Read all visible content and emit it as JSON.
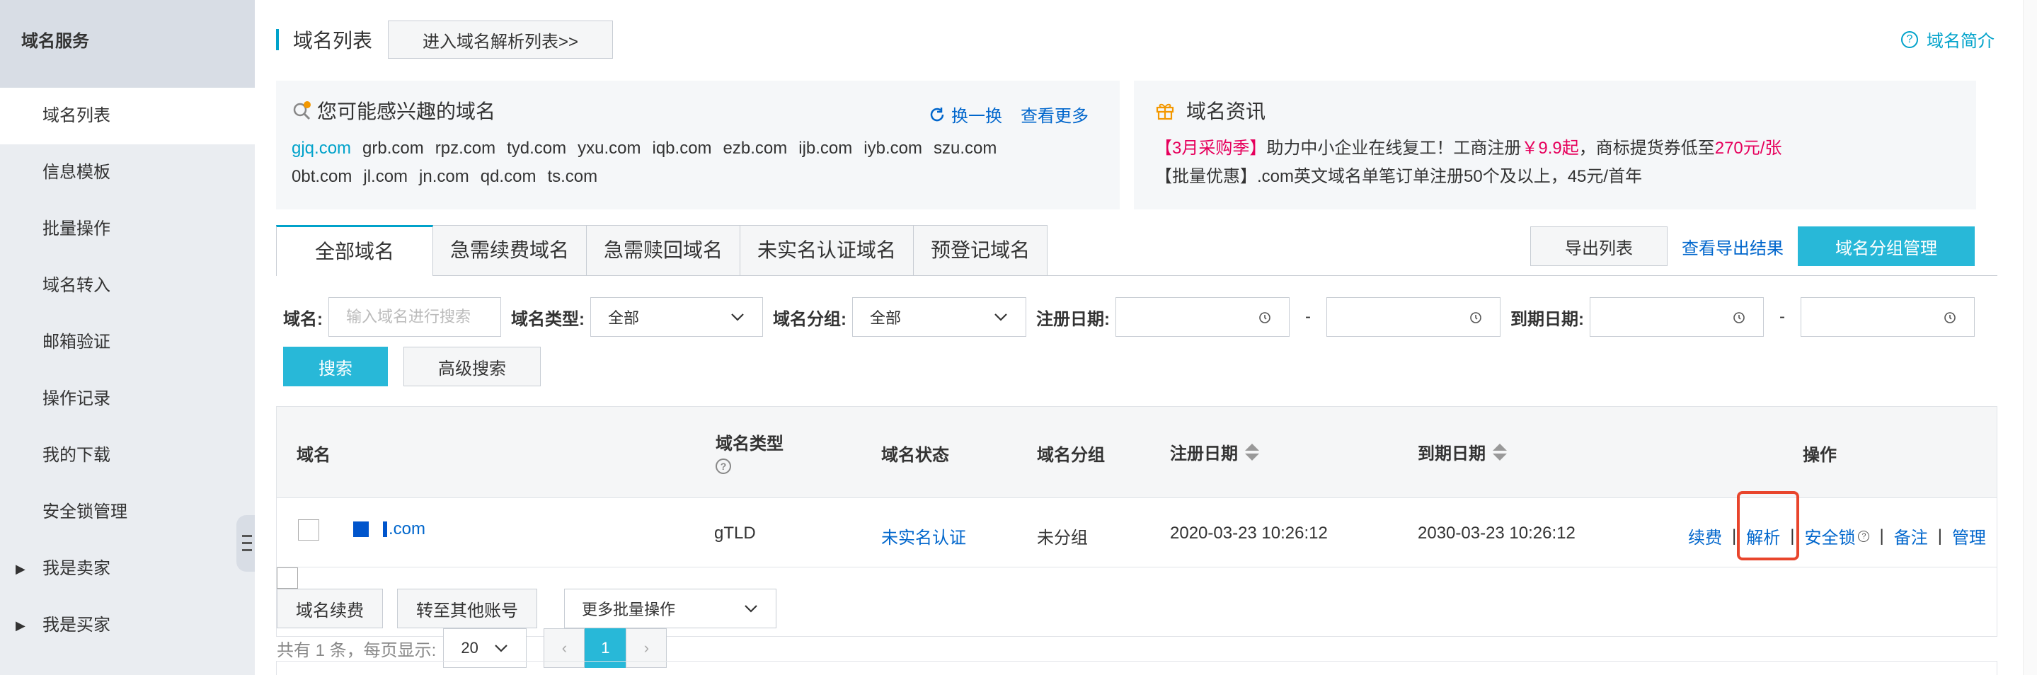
{
  "sidebar": {
    "header": "域名服务",
    "items": [
      {
        "label": "域名列表",
        "active": true
      },
      {
        "label": "信息模板"
      },
      {
        "label": "批量操作"
      },
      {
        "label": "域名转入"
      },
      {
        "label": "邮箱验证"
      },
      {
        "label": "操作记录"
      },
      {
        "label": "我的下载"
      },
      {
        "label": "安全锁管理"
      },
      {
        "label": "我是卖家",
        "expandable": true
      },
      {
        "label": "我是买家",
        "expandable": true
      }
    ]
  },
  "header": {
    "title": "域名列表",
    "enter_button": "进入域名解析列表>>",
    "intro_link": "域名简介"
  },
  "recommend": {
    "title": "您可能感兴趣的域名",
    "refresh": "换一换",
    "more": "查看更多",
    "row1": [
      "gjq.com",
      "grb.com",
      "rpz.com",
      "tyd.com",
      "yxu.com",
      "iqb.com",
      "ezb.com",
      "ijb.com",
      "iyb.com",
      "szu.com"
    ],
    "row2": [
      "0bt.com",
      "jl.com",
      "jn.com",
      "qd.com",
      "ts.com"
    ]
  },
  "news": {
    "title": "域名资讯",
    "line1_tag": "【3月采购季】",
    "line1_text": "助力中小企业在线复工！工商注册",
    "line1_price1": "￥9.9起",
    "line1_mid": "，商标提货券低至",
    "line1_price2": "270元/张",
    "line2": "【批量优惠】.com英文域名单笔订单注册50个及以上，45元/首年"
  },
  "tabs": [
    "全部域名",
    "急需续费域名",
    "急需赎回域名",
    "未实名认证域名",
    "预登记域名"
  ],
  "tools": {
    "export": "导出列表",
    "view_export": "查看导出结果",
    "group_manage": "域名分组管理"
  },
  "filters": {
    "domain_label": "域名:",
    "domain_placeholder": "输入域名进行搜索",
    "type_label": "域名类型:",
    "type_value": "全部",
    "group_label": "域名分组:",
    "group_value": "全部",
    "reg_label": "注册日期:",
    "exp_label": "到期日期:",
    "dash": "-",
    "search": "搜索",
    "advanced": "高级搜索"
  },
  "table": {
    "headers": {
      "domain": "域名",
      "type": "域名类型",
      "status": "域名状态",
      "group": "域名分组",
      "reg_date": "注册日期",
      "exp_date": "到期日期",
      "ops": "操作"
    },
    "rows": [
      {
        "domain": ".com",
        "type": "gTLD",
        "status": "未实名认证",
        "group": "未分组",
        "reg_date": "2020-03-23 10:26:12",
        "exp_date": "2030-03-23 10:26:12",
        "ops": [
          "续费",
          "解析",
          "安全锁",
          "备注",
          "管理"
        ]
      }
    ],
    "footer": {
      "renew": "域名续费",
      "transfer": "转至其他账号",
      "more_batch": "更多批量操作",
      "summary": "共有 1 条，每页显示:",
      "page_size": "20",
      "prev": "‹",
      "current_page": "1",
      "next": "›"
    }
  },
  "colors": {
    "accent": "#28b8d8",
    "link": "#0066cc",
    "highlight": "#e8452c",
    "promo": "#e6005c"
  }
}
